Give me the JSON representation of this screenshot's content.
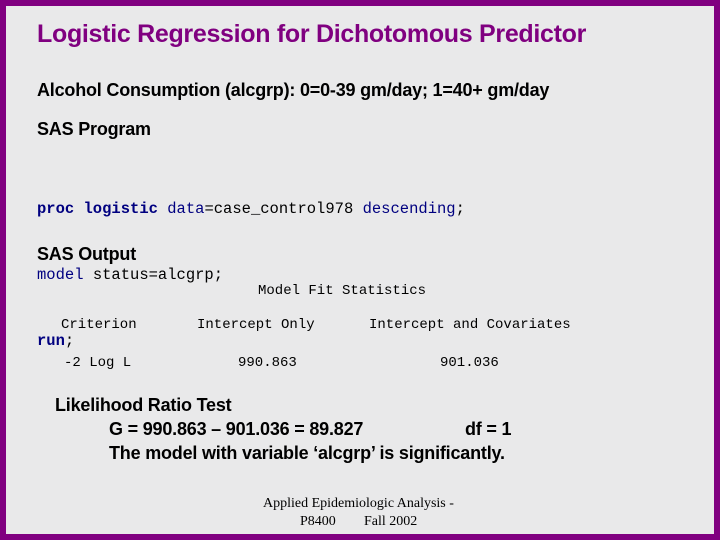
{
  "slide": {
    "title": "Logistic Regression for Dichotomous Predictor",
    "subtitle": "Alcohol Consumption (alcgrp): 0=0-39 gm/day; 1=40+ gm/day",
    "program_heading": "SAS Program",
    "code": {
      "line1": {
        "kw1": "proc logistic",
        "opt1": " data",
        "text1": "=case_control978 ",
        "opt2": "descending",
        "text2": ";"
      },
      "line2": {
        "opt1": "model",
        "text1": " status=alcgrp;"
      },
      "line3": {
        "kw1": "run",
        "text1": ";"
      }
    },
    "output_heading": "SAS Output",
    "fit_table": {
      "title": "Model Fit Statistics",
      "headers": [
        "Criterion",
        "Intercept Only",
        "Intercept and Covariates"
      ],
      "rows": [
        [
          "-2 Log L",
          "990.863",
          "901.036"
        ]
      ]
    },
    "lrt": {
      "heading": "Likelihood Ratio Test",
      "equation": "G = 990.863 – 901.036 = 89.827",
      "df": "df = 1",
      "conclusion": "The model with variable ‘alcgrp’ is significantly."
    },
    "footer": {
      "line1": "Applied Epidemiologic Analysis -",
      "line2a": "P8400",
      "line2b": "Fall 2002"
    }
  }
}
